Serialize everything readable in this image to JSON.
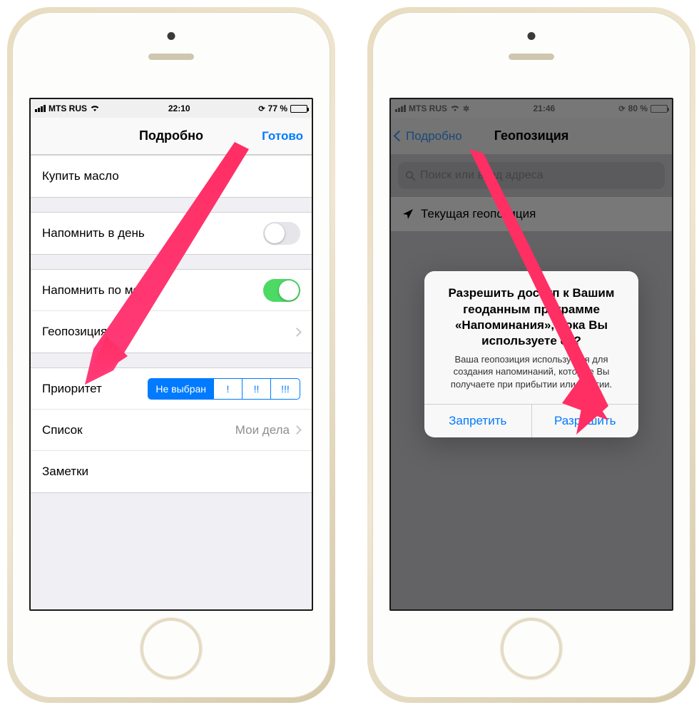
{
  "left": {
    "status": {
      "carrier": "MTS RUS",
      "time": "22:10",
      "battery_pct": "77 %"
    },
    "nav": {
      "title": "Подробно",
      "done": "Готово"
    },
    "rows": {
      "title": "Купить масло",
      "remind_day": "Напомнить в день",
      "remind_place": "Напомнить по месту",
      "location": "Геопозиция",
      "priority_label": "Приоритет",
      "priority_seg": {
        "none": "Не выбран",
        "p1": "!",
        "p2": "!!",
        "p3": "!!!"
      },
      "list_label": "Список",
      "list_value": "Мои дела",
      "notes": "Заметки"
    }
  },
  "right": {
    "status": {
      "carrier": "MTS RUS",
      "time": "21:46",
      "battery_pct": "80 %"
    },
    "nav": {
      "back": "Подробно",
      "title": "Геопозиция"
    },
    "search_placeholder": "Поиск или ввод адреса",
    "current_location": "Текущая геопозиция",
    "alert": {
      "title": "Разрешить доступ к Вашим геоданным программе «Напоминания», пока Вы используете ее?",
      "message": "Ваша геопозиция используется для создания напоминаний, которые Вы получаете при прибытии или убытии.",
      "deny": "Запретить",
      "allow": "Разрешить"
    }
  }
}
